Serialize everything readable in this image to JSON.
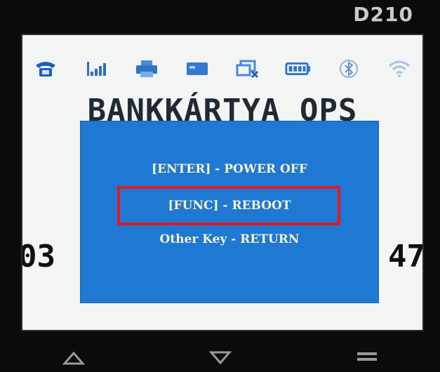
{
  "device": {
    "model": "D210"
  },
  "status_icons": [
    "phone-icon",
    "signal-icon",
    "printer-icon",
    "card-icon",
    "network-icon",
    "battery-icon",
    "bluetooth-icon",
    "wifi-icon"
  ],
  "screen": {
    "title": "BANKKÁRTYA OPS",
    "date_visible": "03",
    "time_visible": "47"
  },
  "dialog": {
    "options": [
      "[ENTER] - POWER OFF",
      "[FUNC] - REBOOT",
      "Other Key - RETURN"
    ],
    "highlighted_index": 1
  },
  "colors": {
    "dialog_bg": "#1f78d1",
    "highlight": "#e01a22",
    "option_text": "#f6f3c8"
  },
  "nav": [
    "back-triangle-icon",
    "home-triangle-icon",
    "menu-lines-icon"
  ]
}
